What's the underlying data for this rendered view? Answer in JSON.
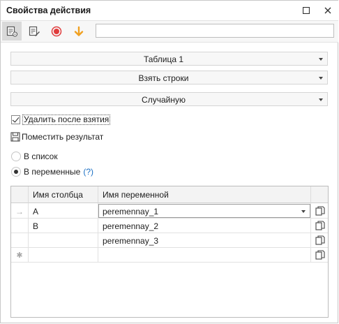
{
  "window": {
    "title": "Свойства действия",
    "maximize_icon": "square-icon",
    "close_icon": "close-icon"
  },
  "toolbar": {
    "tools": [
      {
        "name": "properties-icon",
        "active": true
      },
      {
        "name": "edit-notes-icon",
        "active": false
      },
      {
        "name": "record-icon",
        "active": false,
        "color": "#e03c3c"
      },
      {
        "name": "arrow-down-icon",
        "active": false,
        "color": "#f0a020"
      }
    ],
    "search_value": ""
  },
  "form": {
    "table_select": "Таблица 1",
    "action_select": "Взять строки",
    "mode_select": "Случайную",
    "delete_after_take_label": "Удалить после взятия",
    "delete_after_take_checked": true,
    "place_result_label": "Поместить результат",
    "to_list_label": "В список",
    "to_variables_label": "В переменные",
    "help_link": "(?)",
    "selected_radio": "to_variables"
  },
  "grid": {
    "columns": [
      "Имя столбца",
      "Имя переменной"
    ],
    "rows": [
      {
        "indicator": "→",
        "column": "A",
        "variable": "peremennay_1",
        "has_dropdown": true
      },
      {
        "indicator": "",
        "column": "B",
        "variable": "peremennay_2",
        "has_dropdown": false
      },
      {
        "indicator": "",
        "column": "",
        "variable": "peremennay_3",
        "has_dropdown": false
      },
      {
        "indicator": "✱",
        "column": "",
        "variable": "",
        "has_dropdown": false
      }
    ]
  },
  "colors": {
    "accent_link": "#1a6fc4",
    "record": "#e03c3c",
    "arrow": "#f0a020"
  }
}
